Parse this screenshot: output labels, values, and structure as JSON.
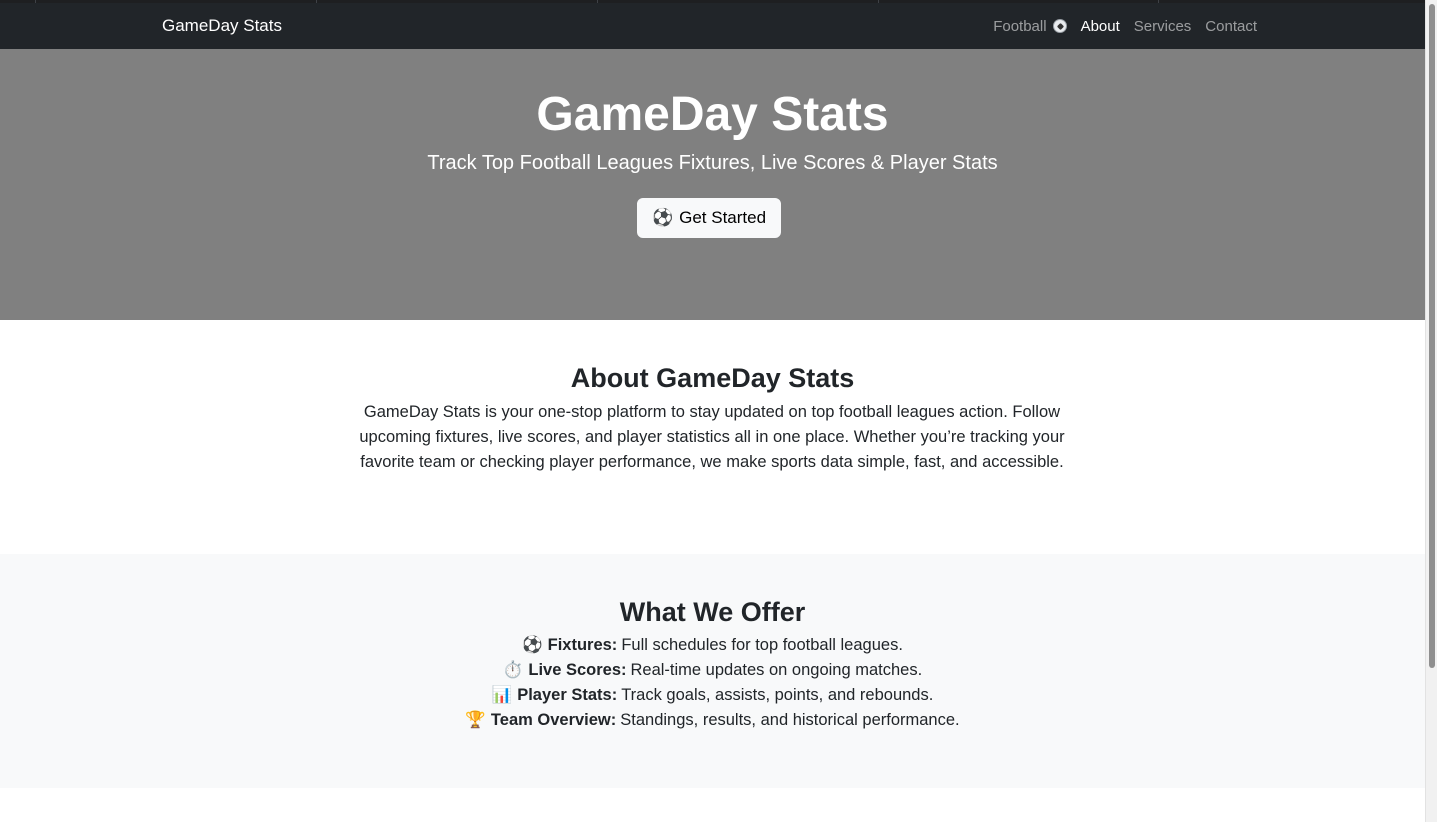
{
  "navbar": {
    "brand": "GameDay Stats",
    "links": [
      {
        "label": "Football",
        "icon": "football-icon"
      },
      {
        "label": "About"
      },
      {
        "label": "Services"
      },
      {
        "label": "Contact"
      }
    ],
    "active": "About"
  },
  "hero": {
    "title": "GameDay Stats",
    "subtitle": "Track Top Football Leagues Fixtures, Live Scores & Player Stats",
    "cta_icon": "⚽",
    "cta_label": "Get Started"
  },
  "about": {
    "heading": "About GameDay Stats",
    "text": "GameDay Stats is your one-stop platform to stay updated on top football leagues action. Follow upcoming fixtures, live scores, and player statistics all in one place. Whether you’re tracking your favorite team or checking player performance, we make sports data simple, fast, and accessible."
  },
  "offer": {
    "heading": "What We Offer",
    "items": [
      {
        "icon": "⚽",
        "name": "Fixtures:",
        "desc": "Full schedules for top football leagues."
      },
      {
        "icon": "⏱️",
        "name": "Live Scores:",
        "desc": "Real-time updates on ongoing matches."
      },
      {
        "icon": "📊",
        "name": "Player Stats:",
        "desc": "Track goals, assists, points, and rebounds."
      },
      {
        "icon": "🏆",
        "name": "Team Overview:",
        "desc": "Standings, results, and historical performance."
      }
    ]
  },
  "colors": {
    "navbar_bg": "#212529",
    "hero_bg": "#808080",
    "offer_bg": "#f8f9fa"
  }
}
